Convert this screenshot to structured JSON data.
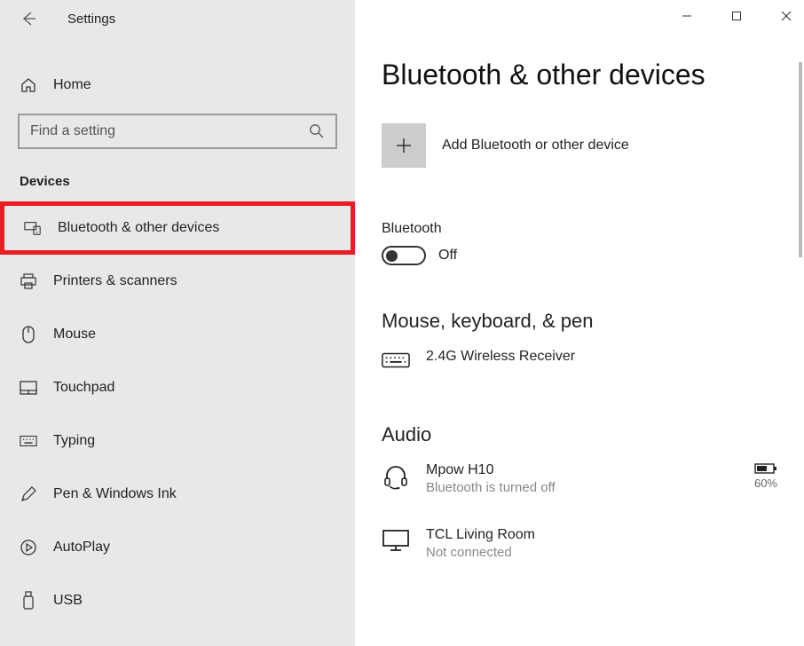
{
  "app_title": "Settings",
  "home_label": "Home",
  "search_placeholder": "Find a setting",
  "section_heading": "Devices",
  "nav_items": [
    {
      "label": "Bluetooth & other devices"
    },
    {
      "label": "Printers & scanners"
    },
    {
      "label": "Mouse"
    },
    {
      "label": "Touchpad"
    },
    {
      "label": "Typing"
    },
    {
      "label": "Pen & Windows Ink"
    },
    {
      "label": "AutoPlay"
    },
    {
      "label": "USB"
    }
  ],
  "page_title": "Bluetooth & other devices",
  "add_device_label": "Add Bluetooth or other device",
  "bluetooth": {
    "label": "Bluetooth",
    "state": "Off"
  },
  "groups": {
    "mouse_keyboard_pen": {
      "title": "Mouse, keyboard, & pen",
      "devices": [
        {
          "name": "2.4G Wireless Receiver"
        }
      ]
    },
    "audio": {
      "title": "Audio",
      "devices": [
        {
          "name": "Mpow H10",
          "status": "Bluetooth is turned off",
          "battery_pct": "60%"
        },
        {
          "name": "TCL Living Room",
          "status": "Not connected"
        }
      ]
    }
  }
}
